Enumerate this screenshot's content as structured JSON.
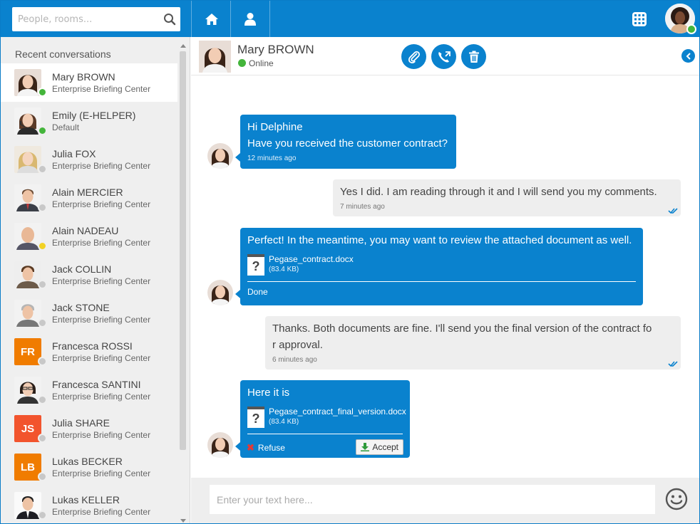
{
  "search": {
    "placeholder": "People, rooms..."
  },
  "sidebar": {
    "title": "Recent conversations",
    "items": [
      {
        "name": "Mary BROWN",
        "sub": "Enterprise Briefing Center",
        "status": "online",
        "initials": "",
        "color": "",
        "active": true,
        "photo": "woman-dark-hair"
      },
      {
        "name": "Emily (E-HELPER)",
        "sub": "Default",
        "status": "online",
        "initials": "",
        "color": "",
        "photo": "woman-headset"
      },
      {
        "name": "Julia FOX",
        "sub": "Enterprise Briefing Center",
        "status": "offline",
        "initials": "",
        "color": "",
        "photo": "woman-blonde"
      },
      {
        "name": "Alain MERCIER",
        "sub": "Enterprise Briefing Center",
        "status": "offline",
        "initials": "",
        "color": "",
        "photo": "man-suit"
      },
      {
        "name": "Alain NADEAU",
        "sub": "Enterprise Briefing Center",
        "status": "away",
        "initials": "",
        "color": "",
        "photo": "man-bald"
      },
      {
        "name": "Jack COLLIN",
        "sub": "Enterprise Briefing Center",
        "status": "offline",
        "initials": "",
        "color": "",
        "photo": "man-brown-hair"
      },
      {
        "name": "Jack STONE",
        "sub": "Enterprise Briefing Center",
        "status": "offline",
        "initials": "",
        "color": "",
        "photo": "man-grey-hair"
      },
      {
        "name": "Francesca ROSSI",
        "sub": "Enterprise Briefing Center",
        "status": "offline",
        "initials": "FR",
        "color": "#f07c00"
      },
      {
        "name": "Francesca SANTINI",
        "sub": "Enterprise Briefing Center",
        "status": "offline",
        "initials": "",
        "color": "",
        "photo": "woman-glasses"
      },
      {
        "name": "Julia SHARE",
        "sub": "Enterprise Briefing Center",
        "status": "offline",
        "initials": "JS",
        "color": "#f2542d"
      },
      {
        "name": "Lukas BECKER",
        "sub": "Enterprise Briefing Center",
        "status": "offline",
        "initials": "LB",
        "color": "#f07c00"
      },
      {
        "name": "Lukas KELLER",
        "sub": "Enterprise Briefing Center",
        "status": "offline",
        "initials": "",
        "color": "",
        "photo": "man-suit-dark"
      }
    ]
  },
  "chat": {
    "contact_name": "Mary BROWN",
    "contact_status": "Online",
    "messages": [
      {
        "dir": "in",
        "lines": [
          "Hi Delphine",
          "Have you received the customer contract?"
        ],
        "time": "12 minutes ago"
      },
      {
        "dir": "out",
        "lines": [
          "Yes I did. I am reading through it and I will send you my comments."
        ],
        "time": "7 minutes ago"
      },
      {
        "dir": "in",
        "lines": [
          "Perfect! In the meantime, you may want to review the attached document as well."
        ],
        "file": {
          "name": "Pegase_contract.docx",
          "size": "(83.4 KB)"
        },
        "state": "Done"
      },
      {
        "dir": "out",
        "lines": [
          "Thanks. Both documents are fine. I'll send you the final version of the contract fo",
          "r approval."
        ],
        "time": "6 minutes ago"
      },
      {
        "dir": "in",
        "lines": [
          "Here it is"
        ],
        "file": {
          "name": "Pegase_contract_final_version.docx",
          "size": "(83.4 KB)"
        },
        "refuse_label": "Refuse",
        "accept_label": "Accept"
      }
    ]
  },
  "composer": {
    "placeholder": "Enter your text here..."
  },
  "colors": {
    "brand": "#0a82ce",
    "online": "#44b53b",
    "away": "#f2d224",
    "offline": "#c8c8c8"
  },
  "icons": [
    "search-icon",
    "home-icon",
    "user-icon",
    "dialpad-icon",
    "paperclip-icon",
    "call-transfer-icon",
    "trash-icon",
    "chevron-left-icon",
    "emoji-icon",
    "download-icon",
    "close-icon",
    "file-icon",
    "checkmark-icon"
  ]
}
